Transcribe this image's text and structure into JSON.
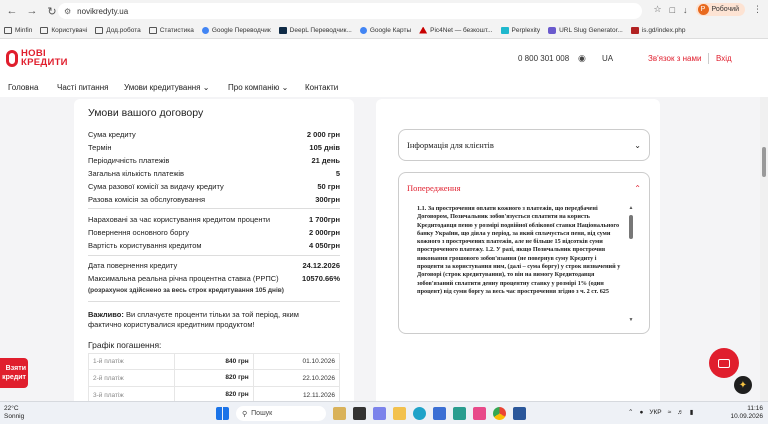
{
  "browser": {
    "url": "novikredyty.ua",
    "profile_label": "Робочий",
    "profile_initial": "Р"
  },
  "bookmarks": [
    {
      "label": "Minfin",
      "icon": "folder-icon"
    },
    {
      "label": "Користувачі",
      "icon": "folder-icon"
    },
    {
      "label": "Дод.робота",
      "icon": "folder-icon"
    },
    {
      "label": "Статистика",
      "icon": "folder-icon"
    },
    {
      "label": "Google Переводчик",
      "icon": "google-translate-icon"
    },
    {
      "label": "DeepL Переводчик...",
      "icon": "deepl-icon"
    },
    {
      "label": "Google Карты",
      "icon": "google-maps-icon"
    },
    {
      "label": "Pic4Net — безкошт...",
      "icon": "pic4net-icon"
    },
    {
      "label": "Perplexity",
      "icon": "perplexity-icon"
    },
    {
      "label": "URL Slug Generator...",
      "icon": "url-slug-icon"
    },
    {
      "label": "is.gd/index.php",
      "icon": "isgd-icon"
    }
  ],
  "site": {
    "logo_line1": "НОВІ",
    "logo_line2": "КРЕДИТИ",
    "phone": "0 800 301 008",
    "lang": "UA",
    "contact_label": "Зв'язок з нами",
    "login_label": "Вхід",
    "nav": [
      "Головна",
      "Часті питання",
      "Умови кредитування",
      "Про компанію",
      "Контакти"
    ]
  },
  "contract": {
    "title": "Умови вашого договору",
    "group1": [
      {
        "label": "Сума кредиту",
        "value": "2 000 грн"
      },
      {
        "label": "Термін",
        "value": "105 днів"
      },
      {
        "label": "Періодичність платежів",
        "value": "21 день"
      },
      {
        "label": "Загальна кількість платежів",
        "value": "5"
      },
      {
        "label": "Сума разової комісії за видачу кредиту",
        "value": "50 грн"
      },
      {
        "label": "Разова комісія за обслуговування",
        "value": "300грн"
      }
    ],
    "group2": [
      {
        "label": "Нараховані за час користування кредитом проценти",
        "value": "1 700грн"
      },
      {
        "label": "Повернення основного боргу",
        "value": "2 000грн"
      },
      {
        "label": "Вартість користування кредитом",
        "value": "4 050грн"
      }
    ],
    "group3": [
      {
        "label": "Дата повернення кредиту",
        "value": "24.12.2026"
      },
      {
        "label": "Максимальна реальна річна процентна ставка (РРПС)",
        "value": "10570.66%"
      }
    ],
    "rrps_note": "(розрахунок здійснено за весь строк кредитування 105 днів)",
    "important_label": "Важливо:",
    "important_text": " Ви сплачуєте проценти тільки за той період, яким фактично користувалися кредитним продуктом!",
    "schedule_title": "Графік погашення:",
    "schedule": [
      {
        "payment": "1-й платіж",
        "amount": "840 грн",
        "date": "01.10.2026"
      },
      {
        "payment": "2-й платіж",
        "amount": "820 грн",
        "date": "22.10.2026"
      },
      {
        "payment": "3-й платіж",
        "amount": "820 грн",
        "date": "12.11.2026"
      }
    ]
  },
  "accordion": {
    "info_title": "Інформація для клієнтів",
    "warning_title": "Попередження",
    "warning_text": "1.1. За прострочення оплати кожного з платежів, що передбачені Договором, Позичальник зобов'язується сплатити на користь Кредитодавця пеню у розмірі подвійної облікової ставки Національного банку України, що діяла у період, за який сплачується пеня, від суми кожного з прострочених платежів, але не більше 15 відсотків суми простроченого платежу. 1.2. У разі, якщо Позичальник прострочив виконання грошового зобов'язання (не повернув суму Кредиту і проценти за користування ним, (далі – сума боргу) у строк визначений у Договорі (строк кредитування), то він на вимогу Кредитодавця зобов'язаний сплатити денну процентну ставку у розмірі 1% (один процент) від суми боргу за весь час прострочення згідно з ч. 2 ст. 625"
  },
  "floating": {
    "take_credit": "Взяти кредит"
  },
  "taskbar": {
    "temp": "22°C",
    "weather": "Sonnig",
    "search_placeholder": "Пошук",
    "lang": "УКР",
    "time": "11:16",
    "date": "10.09.2026"
  },
  "colors": {
    "brand_red": "#e01e2d",
    "page_bg": "#f4f4f6"
  }
}
